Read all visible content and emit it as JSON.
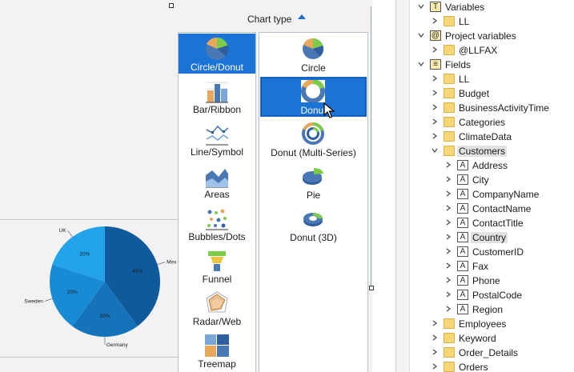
{
  "chart_type_panel": {
    "header_label": "Chart type",
    "categories": [
      {
        "label": "Circle/Donut",
        "icon": "circle-donut-icon",
        "selected": true
      },
      {
        "label": "Bar/Ribbon",
        "icon": "bar-ribbon-icon",
        "selected": false
      },
      {
        "label": "Line/Symbol",
        "icon": "line-symbol-icon",
        "selected": false
      },
      {
        "label": "Areas",
        "icon": "areas-icon",
        "selected": false
      },
      {
        "label": "Bubbles/Dots",
        "icon": "bubbles-dots-icon",
        "selected": false
      },
      {
        "label": "Funnel",
        "icon": "funnel-icon",
        "selected": false
      },
      {
        "label": "Radar/Web",
        "icon": "radar-web-icon",
        "selected": false
      },
      {
        "label": "Treemap",
        "icon": "treemap-icon",
        "selected": false
      }
    ],
    "subtypes": [
      {
        "label": "Circle",
        "icon": "circle-chart-icon",
        "selected": false
      },
      {
        "label": "Donut",
        "icon": "donut-chart-icon",
        "selected": true
      },
      {
        "label": "Donut (Multi-Series)",
        "icon": "donut-multi-series-icon",
        "selected": false
      },
      {
        "label": "Pie",
        "icon": "pie-chart-icon",
        "selected": false
      },
      {
        "label": "Donut (3D)",
        "icon": "donut-3d-icon",
        "selected": false
      }
    ]
  },
  "preview_chart": {
    "slices": [
      {
        "name": "Mexico",
        "label": "Mex",
        "percent_label": "40%",
        "value": 40,
        "color": "#0f5a9a"
      },
      {
        "name": "Germany",
        "label": "Germany",
        "percent_label": "20%",
        "value": 20,
        "color": "#1573b9"
      },
      {
        "name": "Sweden",
        "label": "Sweden",
        "percent_label": "20%",
        "value": 20,
        "color": "#198bd4"
      },
      {
        "name": "UK",
        "label": "UK",
        "percent_label": "20%",
        "value": 20,
        "color": "#22a3ea"
      }
    ]
  },
  "tree": {
    "nodes": [
      {
        "label": "Variables",
        "icon": "variables-icon",
        "level": 0,
        "expanded": true
      },
      {
        "label": "LL",
        "icon": "folder-icon",
        "level": 1,
        "expanded": false
      },
      {
        "label": "Project variables",
        "icon": "project-variables-icon",
        "level": 0,
        "expanded": true
      },
      {
        "label": "@LLFAX",
        "icon": "folder-icon",
        "level": 1,
        "expanded": false
      },
      {
        "label": "Fields",
        "icon": "fields-icon",
        "level": 0,
        "expanded": true
      },
      {
        "label": "LL",
        "icon": "folder-icon",
        "level": 1,
        "expanded": false
      },
      {
        "label": "Budget",
        "icon": "folder-icon",
        "level": 1,
        "expanded": false
      },
      {
        "label": "BusinessActivityTime",
        "icon": "folder-icon",
        "level": 1,
        "expanded": false
      },
      {
        "label": "Categories",
        "icon": "folder-icon",
        "level": 1,
        "expanded": false
      },
      {
        "label": "ClimateData",
        "icon": "folder-icon",
        "level": 1,
        "expanded": false
      },
      {
        "label": "Customers",
        "icon": "folder-icon",
        "level": 1,
        "expanded": true,
        "highlighted": true
      },
      {
        "label": "Address",
        "icon": "text-field-icon",
        "level": 2,
        "expanded": false
      },
      {
        "label": "City",
        "icon": "text-field-icon",
        "level": 2,
        "expanded": false
      },
      {
        "label": "CompanyName",
        "icon": "text-field-icon",
        "level": 2,
        "expanded": false
      },
      {
        "label": "ContactName",
        "icon": "text-field-icon",
        "level": 2,
        "expanded": false
      },
      {
        "label": "ContactTitle",
        "icon": "text-field-icon",
        "level": 2,
        "expanded": false
      },
      {
        "label": "Country",
        "icon": "text-field-icon",
        "level": 2,
        "expanded": false,
        "highlighted": true
      },
      {
        "label": "CustomerID",
        "icon": "text-field-icon",
        "level": 2,
        "expanded": false
      },
      {
        "label": "Fax",
        "icon": "text-field-icon",
        "level": 2,
        "expanded": false
      },
      {
        "label": "Phone",
        "icon": "text-field-icon",
        "level": 2,
        "expanded": false
      },
      {
        "label": "PostalCode",
        "icon": "text-field-icon",
        "level": 2,
        "expanded": false
      },
      {
        "label": "Region",
        "icon": "text-field-icon",
        "level": 2,
        "expanded": false
      },
      {
        "label": "Employees",
        "icon": "folder-icon",
        "level": 1,
        "expanded": false
      },
      {
        "label": "Keyword",
        "icon": "folder-icon",
        "level": 1,
        "expanded": false
      },
      {
        "label": "Order_Details",
        "icon": "folder-icon",
        "level": 1,
        "expanded": false
      },
      {
        "label": "Orders",
        "icon": "folder-icon",
        "level": 1,
        "expanded": false
      }
    ]
  }
}
